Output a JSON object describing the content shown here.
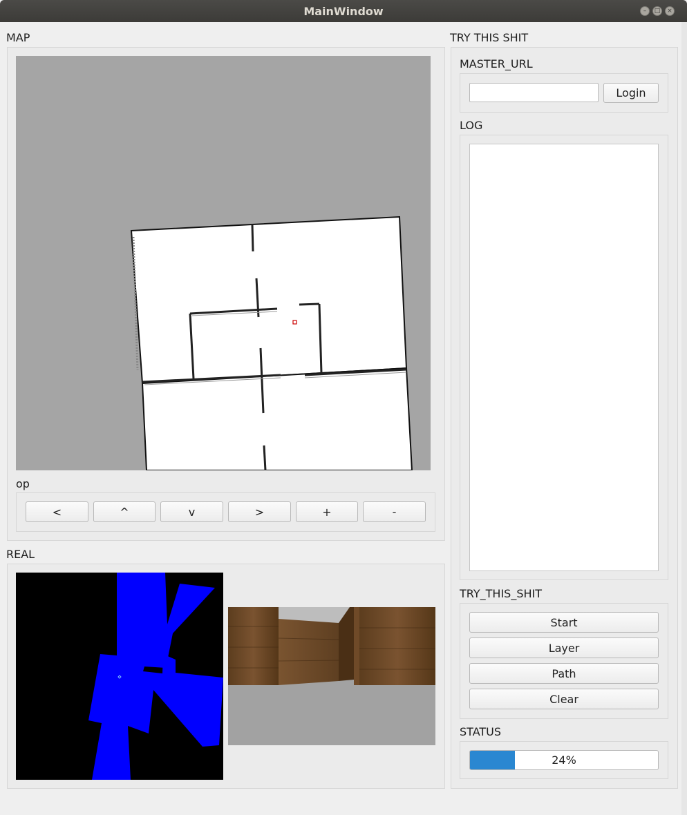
{
  "window": {
    "title": "MainWindow"
  },
  "map_panel": {
    "label": "MAP",
    "robot_marker_color": "#cc0000",
    "op": {
      "label": "op",
      "buttons": [
        "<",
        "^",
        "v",
        ">",
        "+",
        "-"
      ]
    }
  },
  "real_panel": {
    "label": "REAL"
  },
  "right_panel": {
    "label": "TRY THIS SHIT",
    "master_url": {
      "label": "MASTER_URL",
      "value": "",
      "placeholder": "",
      "login_label": "Login"
    },
    "log": {
      "label": "LOG",
      "content": ""
    },
    "actions": {
      "label": "TRY_THIS_SHIT",
      "buttons": [
        "Start",
        "Layer",
        "Path",
        "Clear"
      ]
    },
    "status": {
      "label": "STATUS",
      "progress_text": "24%",
      "progress_fraction": 0.24,
      "progress_color": "#2a87d1"
    }
  }
}
